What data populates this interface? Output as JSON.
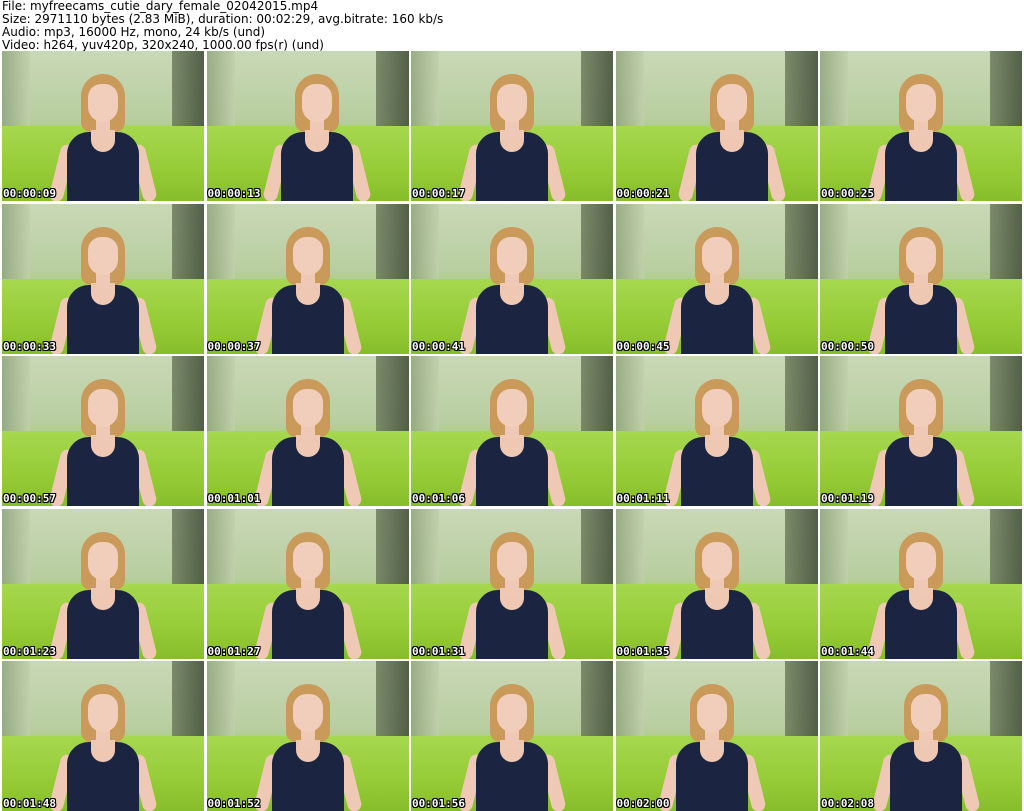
{
  "header": {
    "file": "File: myfreecams_cutie_dary_female_02042015.mp4",
    "size": "Size: 2971110 bytes (2.83 MiB), duration: 00:02:29, avg.bitrate: 160 kb/s",
    "audio": "Audio: mp3, 16000 Hz, mono, 24 kb/s (und)",
    "video": "Video: h264, yuv420p, 320x240, 1000.00 fps(r) (und)"
  },
  "frames": [
    {
      "time": "00:00:09"
    },
    {
      "time": "00:00:13"
    },
    {
      "time": "00:00:17"
    },
    {
      "time": "00:00:21"
    },
    {
      "time": "00:00:25"
    },
    {
      "time": "00:00:33"
    },
    {
      "time": "00:00:37"
    },
    {
      "time": "00:00:41"
    },
    {
      "time": "00:00:45"
    },
    {
      "time": "00:00:50"
    },
    {
      "time": "00:00:57"
    },
    {
      "time": "00:01:01"
    },
    {
      "time": "00:01:06"
    },
    {
      "time": "00:01:11"
    },
    {
      "time": "00:01:19"
    },
    {
      "time": "00:01:23"
    },
    {
      "time": "00:01:27"
    },
    {
      "time": "00:01:31"
    },
    {
      "time": "00:01:35"
    },
    {
      "time": "00:01:44"
    },
    {
      "time": "00:01:48"
    },
    {
      "time": "00:01:52"
    },
    {
      "time": "00:01:56"
    },
    {
      "time": "00:02:00"
    },
    {
      "time": "00:02:08"
    }
  ]
}
